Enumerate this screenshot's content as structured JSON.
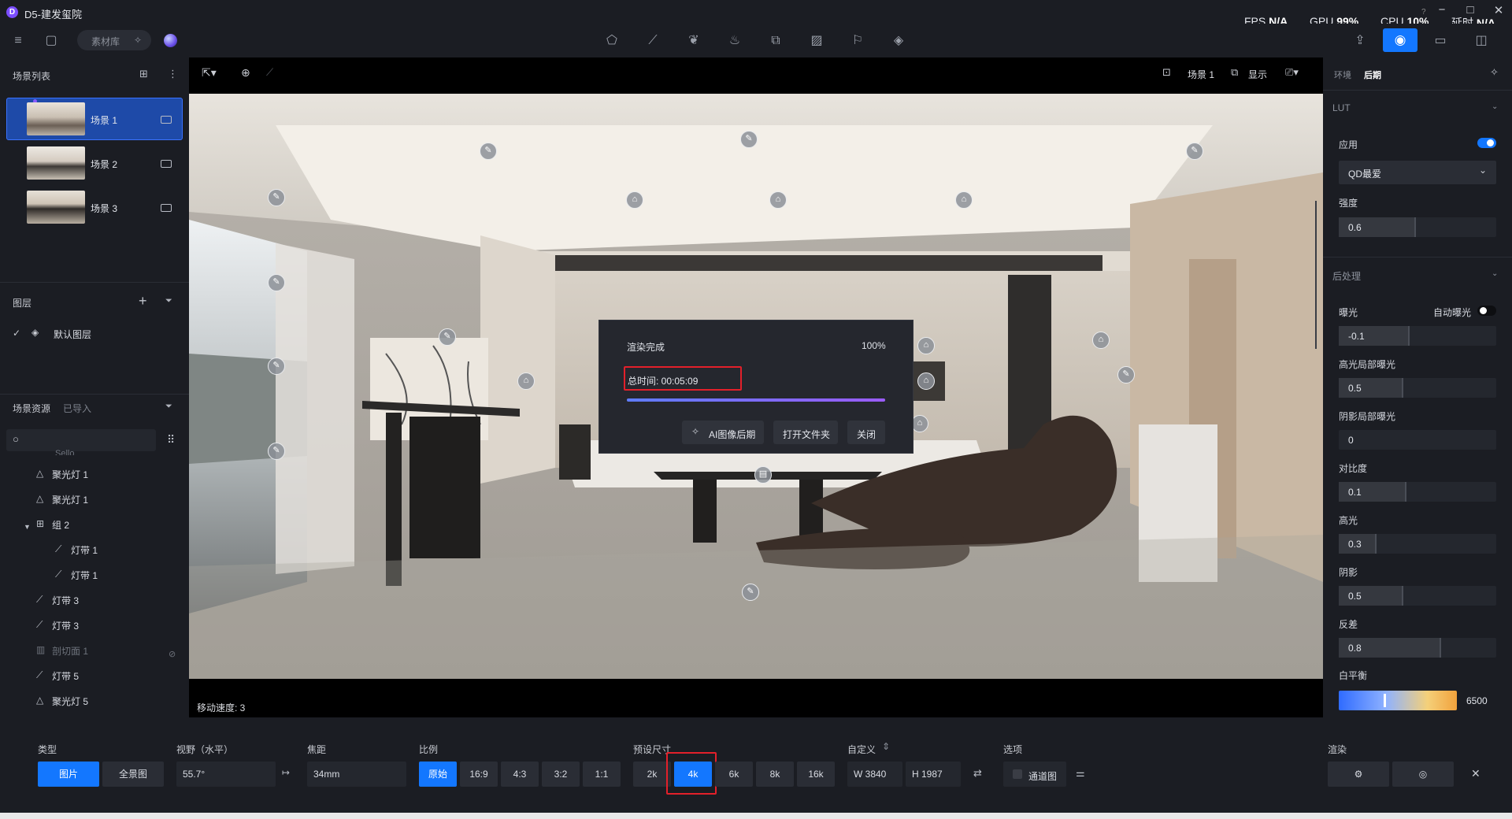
{
  "app": {
    "logo_letter": "D",
    "title": "D5-建发玺院"
  },
  "stats": [
    {
      "label": "FPS",
      "value": "N/A"
    },
    {
      "label": "GPU",
      "value": "99%"
    },
    {
      "label": "CPU",
      "value": "10%"
    },
    {
      "label": "延时",
      "value": "N/A"
    }
  ],
  "toolbar": {
    "material_library": "素材库"
  },
  "scene_list": {
    "title": "场景列表",
    "items": [
      {
        "label": "场景 1",
        "active": true
      },
      {
        "label": "场景 2",
        "active": false
      },
      {
        "label": "场景 3",
        "active": false
      }
    ]
  },
  "layers": {
    "title": "图层",
    "items": [
      {
        "label": "默认图层"
      }
    ]
  },
  "assets": {
    "title": "场景资源",
    "tab_imported": "已导入",
    "partial_label": "Sello",
    "tree": [
      {
        "label": "聚光灯 1",
        "icon": "spotlight-icon",
        "indent": 0
      },
      {
        "label": "聚光灯 1",
        "icon": "spotlight-icon",
        "indent": 0
      },
      {
        "label": "组 2",
        "icon": "group-icon",
        "indent": 0
      },
      {
        "label": "灯带 1",
        "icon": "lightstrip-icon",
        "indent": 1
      },
      {
        "label": "灯带 1",
        "icon": "lightstrip-icon",
        "indent": 1
      },
      {
        "label": "灯带 3",
        "icon": "lightstrip-icon",
        "indent": 0
      },
      {
        "label": "灯带 3",
        "icon": "lightstrip-icon",
        "indent": 0
      },
      {
        "label": "剖切面 1",
        "icon": "section-plane-icon",
        "indent": 0,
        "muted": true
      },
      {
        "label": "灯带 5",
        "icon": "lightstrip-icon",
        "indent": 0
      },
      {
        "label": "聚光灯 5",
        "icon": "spotlight-icon",
        "indent": 0
      }
    ]
  },
  "viewport": {
    "scene_label": "场景 1",
    "display_label": "显示",
    "move_speed": "移动速度: 3"
  },
  "render_dialog": {
    "status": "渲染完成",
    "percent_text": "100%",
    "progress": 1.0,
    "total_time": "总时间:  00:05:09",
    "btn_ai": "AI图像后期",
    "btn_open": "打开文件夹",
    "btn_close": "关闭"
  },
  "right_panel": {
    "tab_env": "环境",
    "tab_post": "后期",
    "lut": {
      "section": "LUT",
      "apply_label": "应用",
      "apply_on": true,
      "preset": "QD最爱",
      "strength_label": "强度",
      "strength": {
        "value": "0.6",
        "level": 0.49
      }
    },
    "post": {
      "section": "后处理",
      "auto_exposure_label": "自动曝光",
      "auto_exposure_on": false,
      "sliders": [
        {
          "label": "曝光",
          "value": "-0.1",
          "level": 0.45
        },
        {
          "label": "高光局部曝光",
          "value": "0.5",
          "level": 0.41
        },
        {
          "label": "阴影局部曝光",
          "value": "0",
          "level": 0.0
        },
        {
          "label": "对比度",
          "value": "0.1",
          "level": 0.43
        },
        {
          "label": "高光",
          "value": "0.3",
          "level": 0.24
        },
        {
          "label": "阴影",
          "value": "0.5",
          "level": 0.41
        },
        {
          "label": "反差",
          "value": "0.8",
          "level": 0.65
        }
      ],
      "white_balance_label": "白平衡",
      "white_balance": "6500"
    }
  },
  "bottom": {
    "type_label": "类型",
    "type_options": [
      "图片",
      "全景图"
    ],
    "type_selected": 0,
    "fov_label": "视野（水平）",
    "fov_value": "55.7°",
    "focal_label": "焦距",
    "focal_value": "34mm",
    "ratio_label": "比例",
    "ratio_options": [
      "原始",
      "16:9",
      "4:3",
      "3:2",
      "1:1"
    ],
    "ratio_selected": 0,
    "preset_label": "预设尺寸",
    "preset_options": [
      "2k",
      "4k",
      "6k",
      "8k",
      "16k"
    ],
    "preset_selected": 1,
    "custom_label": "自定义",
    "width": "W  3840",
    "height": "H  1987",
    "options_label": "选项",
    "channel_label": "通道图",
    "render_label": "渲染"
  },
  "colors": {
    "accent": "#1377ff",
    "highlight": "#e3202a",
    "panel": "#1b1d23"
  }
}
